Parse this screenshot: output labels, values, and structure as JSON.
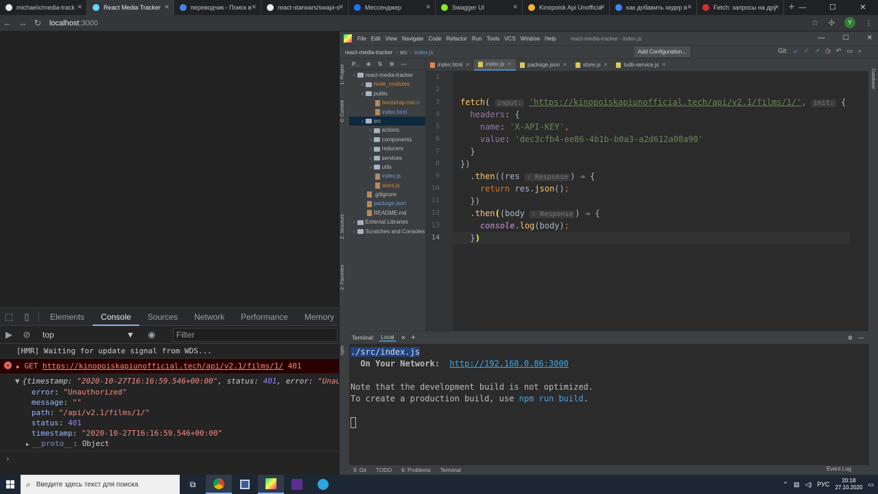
{
  "browser": {
    "tabs": [
      {
        "title": "michaelx/media-track",
        "color": "#e8eaed"
      },
      {
        "title": "React Media Tracker",
        "color": "#61dafb",
        "active": true
      },
      {
        "title": "переводчик - Поиск в",
        "color": "#4285f4"
      },
      {
        "title": "react-starwars/swapi-s",
        "color": "#e8eaed"
      },
      {
        "title": "Мессенджер",
        "color": "#1877f2"
      },
      {
        "title": "Swagger UI",
        "color": "#85ea2d"
      },
      {
        "title": "Kinopoisk Api Unofficia",
        "color": "#f9b234"
      },
      {
        "title": "как добавить хедер в",
        "color": "#4285f4"
      },
      {
        "title": "Fetch: запросы на дру",
        "color": "#d32f2f"
      }
    ],
    "url_host": "localhost",
    "url_port": ":3000",
    "avatar_letter": "Y"
  },
  "devtools": {
    "tabs": [
      "Elements",
      "Console",
      "Sources",
      "Network",
      "Performance",
      "Memory"
    ],
    "active_tab": "Console",
    "context": "top",
    "filter_placeholder": "Filter",
    "console": {
      "hmr": "[HMR] Waiting for update signal from WDS...",
      "error_method": "GET",
      "error_url": "https://kinopoiskapiunofficial.tech/api/v2.1/films/1/",
      "error_code": "401",
      "obj_summary_pre": "{timestamp: ",
      "obj_summary_ts": "\"2020-10-27T16:16:59.546+00:00\"",
      "obj_summary_mid": ", status: ",
      "obj_summary_status": "401",
      "obj_summary_mid2": ", error: ",
      "obj_summary_err": "\"Unau",
      "props": [
        {
          "key": "error",
          "value": "\"Unauthorized\"",
          "type": "str"
        },
        {
          "key": "message",
          "value": "\"\"",
          "type": "str"
        },
        {
          "key": "path",
          "value": "\"/api/v2.1/films/1/\"",
          "type": "str"
        },
        {
          "key": "status",
          "value": "401",
          "type": "num"
        },
        {
          "key": "timestamp",
          "value": "\"2020-10-27T16:16:59.546+00:00\"",
          "type": "str"
        }
      ],
      "proto_key": "__proto__",
      "proto_value": "Object"
    }
  },
  "ide": {
    "menu": [
      "File",
      "Edit",
      "View",
      "Navigate",
      "Code",
      "Refactor",
      "Run",
      "Tools",
      "VCS",
      "Window",
      "Help"
    ],
    "title": "react-media-tracker - index.js",
    "nav": {
      "project": "react-media-tracker",
      "folder": "src",
      "file": "index.js"
    },
    "add_config": "Add Configuration...",
    "git_label": "Git:",
    "project_label": "P...",
    "tree": [
      {
        "label": "react-media-tracker",
        "indent": 0,
        "kind": "fold",
        "cls": ""
      },
      {
        "label": "node_modules",
        "indent": 1,
        "kind": "fold",
        "cls": "orange"
      },
      {
        "label": "public",
        "indent": 1,
        "kind": "fold",
        "cls": ""
      },
      {
        "label": "bootstrap.min.c",
        "indent": 2,
        "kind": "file",
        "cls": "orange"
      },
      {
        "label": "index.html",
        "indent": 2,
        "kind": "file",
        "cls": "blue"
      },
      {
        "label": "src",
        "indent": 1,
        "kind": "fold",
        "cls": "",
        "sel": true
      },
      {
        "label": "actions",
        "indent": 2,
        "kind": "fold",
        "cls": ""
      },
      {
        "label": "components",
        "indent": 2,
        "kind": "fold",
        "cls": ""
      },
      {
        "label": "reducers",
        "indent": 2,
        "kind": "fold",
        "cls": ""
      },
      {
        "label": "services",
        "indent": 2,
        "kind": "fold",
        "cls": ""
      },
      {
        "label": "utils",
        "indent": 2,
        "kind": "fold",
        "cls": ""
      },
      {
        "label": "index.js",
        "indent": 2,
        "kind": "file",
        "cls": "blue"
      },
      {
        "label": "store.js",
        "indent": 2,
        "kind": "file",
        "cls": "orange"
      },
      {
        "label": ".gitignore",
        "indent": 1,
        "kind": "file",
        "cls": ""
      },
      {
        "label": "package.json",
        "indent": 1,
        "kind": "file",
        "cls": "blue"
      },
      {
        "label": "README.md",
        "indent": 1,
        "kind": "file",
        "cls": ""
      },
      {
        "label": "External Libraries",
        "indent": 0,
        "kind": "fold",
        "cls": ""
      },
      {
        "label": "Scratches and Consoles",
        "indent": 0,
        "kind": "fold",
        "cls": ""
      }
    ],
    "editor_tabs": [
      {
        "label": "index.html",
        "color": "#e4864a"
      },
      {
        "label": "index.js",
        "color": "#d8c75a",
        "active": true
      },
      {
        "label": "package.json",
        "color": "#d8c75a"
      },
      {
        "label": "store.js",
        "color": "#d8c75a"
      },
      {
        "label": "tvdb-service.js",
        "color": "#d8c75a"
      }
    ],
    "code": {
      "fetch": "fetch(",
      "hint_input": "input:",
      "url": "'https://kinopoiskapiunofficial.tech/api/v2.1/films/1/'",
      "hint_init": "init:",
      "headers": "headers",
      "name_key": "name",
      "name_val": "'X-API-KEY'",
      "value_key": "value",
      "value_val": "'dec3cfb4-ee86-4b1b-b0a3-a2d612a08a90'",
      "then": "then",
      "res": "res",
      "hint_response": ": Response",
      "return": "return",
      "json": "json",
      "body": "body",
      "console": "console",
      "log": "log"
    },
    "terminal": {
      "tab_label": "Terminal:",
      "session": "Local",
      "line_path": "./src/index.js",
      "network_label": "  On Your Network:  ",
      "network_url": "http://192.168.0.86:3000",
      "note": "Note that the development build is not optimized.",
      "prod_pre": "To create a production build, use ",
      "prod_cmd": "npm run build",
      "prod_post": "."
    },
    "bottom_tabs": [
      "9: Git",
      "TODO",
      "6: Problems",
      "Terminal"
    ],
    "event_log": "Event Log",
    "side_tabs_left": [
      "1: Project",
      "0: Commit",
      "Z: Structure",
      "2: Favorites",
      "npm"
    ],
    "side_tab_right": "Database"
  },
  "taskbar": {
    "search_placeholder": "Введите здесь текст для поиска",
    "lang": "РУС",
    "time": "20:18",
    "date": "27.10.2020"
  }
}
